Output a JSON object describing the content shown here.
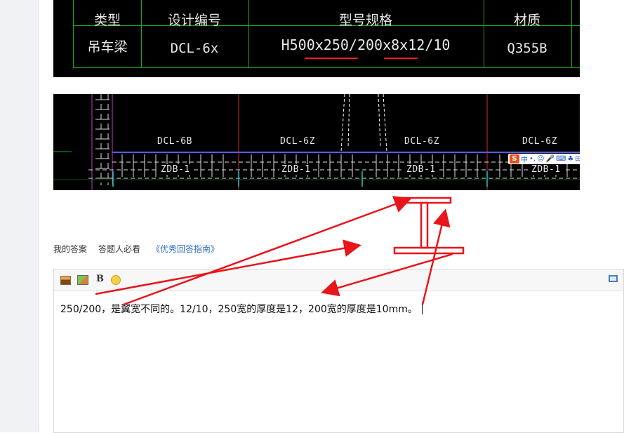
{
  "cad_table": {
    "headers": [
      "类型",
      "设计编号",
      "型号规格",
      "材质"
    ],
    "row": [
      "吊车梁",
      "DCL-6x",
      "H500x250/200x8x12/10",
      "Q355B"
    ]
  },
  "cad_plan": {
    "beam_labels": [
      "DCL-6B",
      "DCL-6Z",
      "DCL-6Z",
      "DCL-6Z"
    ],
    "slab_labels": [
      "ZDB-1",
      "ZDB-1",
      "ZDB-1",
      "ZDB-1"
    ],
    "ime": {
      "logo": "S",
      "items": [
        "中",
        "•,",
        "☺",
        "🎤",
        "⌨",
        "♣",
        "⊞"
      ]
    }
  },
  "answer_tabs": {
    "my_answer": "我的答案",
    "must_read": "答题人必看",
    "guide_link": "《优秀回答指南》"
  },
  "editor": {
    "toolbar": {
      "bold": "B"
    },
    "content": "250/200，是翼宽不同的。12/10，250宽的厚度是12，200宽的厚度是10mm。"
  },
  "colors": {
    "annotation_red": "#e8151b",
    "cad_green": "#1aa81a",
    "link_blue": "#2f6fc6"
  },
  "icons": [
    "image-icon",
    "photo-icon",
    "bold-icon",
    "emoji-icon",
    "fullscreen-icon"
  ]
}
